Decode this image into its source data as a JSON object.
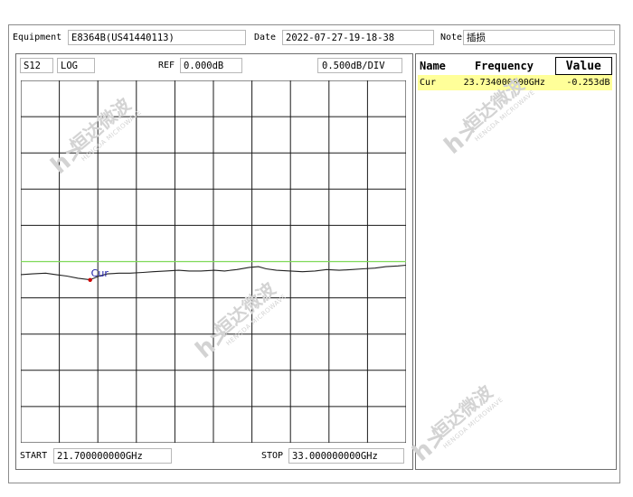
{
  "header": {
    "equipment_label": "Equipment",
    "equipment_value": "E8364B(US41440113)",
    "date_label": "Date",
    "date_value": "2022-07-27-19-18-38",
    "note_label": "Note",
    "note_value": "插损"
  },
  "plot_header": {
    "param": "S12",
    "format": "LOG",
    "ref_label": "REF",
    "ref_value": "0.000dB",
    "scale": "0.500dB/DIV"
  },
  "plot_footer": {
    "start_label": "START",
    "start_value": "21.700000000GHz",
    "stop_label": "STOP",
    "stop_value": "33.000000000GHz"
  },
  "marker_label": "Cur",
  "marker_table": {
    "headers": [
      "Name",
      "Frequency",
      "Value"
    ],
    "rows": [
      {
        "name": "Cur",
        "frequency": "23.734000000GHz",
        "value": "-0.253dB"
      }
    ]
  },
  "watermark": {
    "text": "恒达微波",
    "sub": "HENGDA MICROWAVE",
    "logo": "h>"
  },
  "colors": {
    "trace": "#222222",
    "ref_line": "#7ed957",
    "marker": "#cc0000",
    "marker_label": "#1a1aa6",
    "highlight": "#ffff99"
  },
  "chart_data": {
    "type": "line",
    "title": "",
    "xlabel": "",
    "ylabel": "",
    "x_unit": "GHz",
    "y_unit": "dB",
    "xlim": [
      21.7,
      33.0
    ],
    "ylim": [
      -5.0,
      0.0
    ],
    "grid": true,
    "series": [
      {
        "name": "",
        "x": [
          21.7,
          22.04,
          22.43,
          22.73,
          23.05,
          23.38,
          23.73,
          24.0,
          24.24,
          24.58,
          24.9,
          25.28,
          25.58,
          25.95,
          26.33,
          26.64,
          26.98,
          27.38,
          27.68,
          28.04,
          28.4,
          28.67,
          28.9,
          29.2,
          29.61,
          29.96,
          30.33,
          30.67,
          31.04,
          31.41,
          31.73,
          32.09,
          32.41,
          32.76,
          33.0
        ],
        "values": [
          -0.18,
          -0.17,
          -0.16,
          -0.18,
          -0.2,
          -0.23,
          -0.25,
          -0.2,
          -0.17,
          -0.16,
          -0.16,
          -0.15,
          -0.14,
          -0.13,
          -0.12,
          -0.13,
          -0.13,
          -0.12,
          -0.13,
          -0.11,
          -0.08,
          -0.07,
          -0.1,
          -0.12,
          -0.13,
          -0.14,
          -0.13,
          -0.11,
          -0.12,
          -0.11,
          -0.1,
          -0.09,
          -0.07,
          -0.06,
          -0.05
        ]
      }
    ],
    "ref_line": 0.0,
    "marker": {
      "name": "Cur",
      "x": 23.734,
      "y": -0.253
    }
  }
}
